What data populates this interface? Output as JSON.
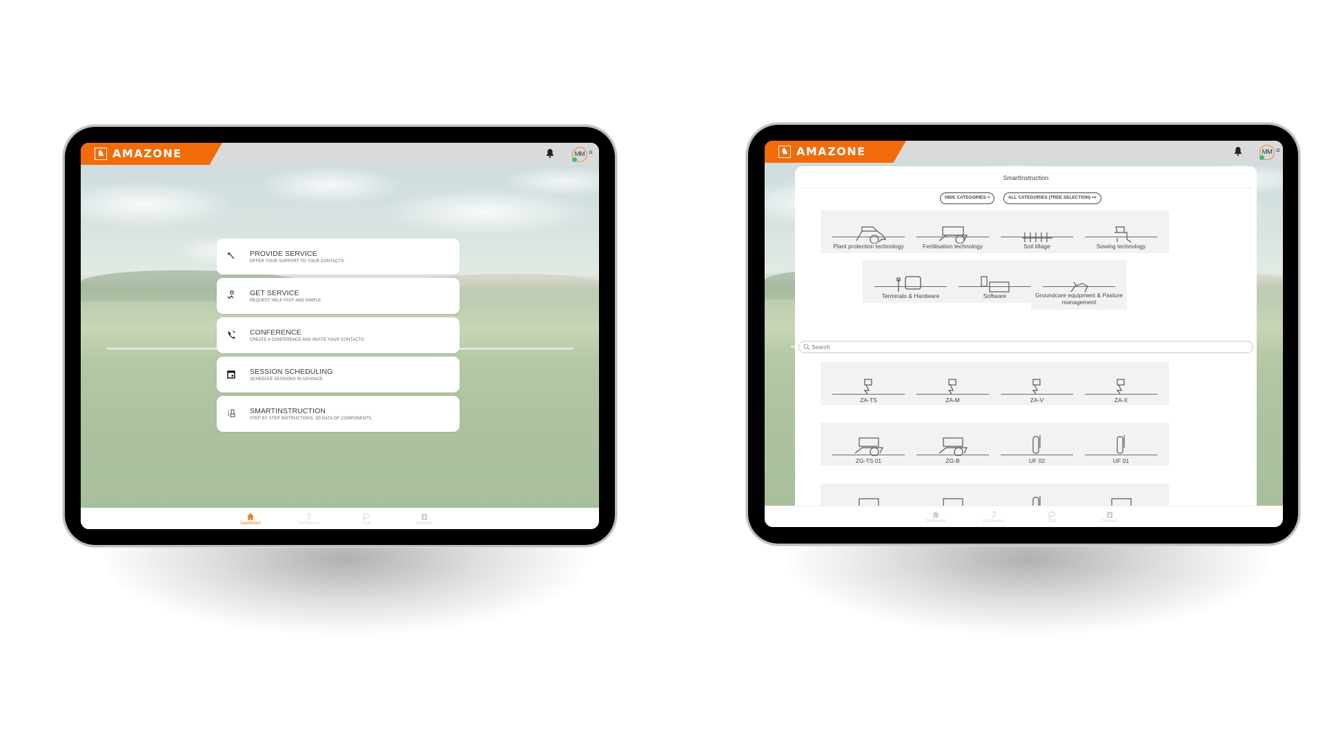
{
  "brand": {
    "name": "AMAZONE",
    "accent_color": "#f26b0a"
  },
  "header": {
    "user_initials": "MM",
    "notifications_icon": "bell-icon",
    "menu_icon": "hamburger-icon",
    "presence_status": "online"
  },
  "dashboard": {
    "cards": [
      {
        "title": "PROVIDE SERVICE",
        "subtitle": "OFFER YOUR SUPPORT TO YOUR CONTACTS.",
        "icon": "wrench-icon"
      },
      {
        "title": "GET SERVICE",
        "subtitle": "REQUEST HELP FAST AND SIMPLE.",
        "icon": "person-support-icon"
      },
      {
        "title": "CONFERENCE",
        "subtitle": "CREATE A CONFERENCE AND INVITE YOUR CONTACTS.",
        "icon": "phone-icon"
      },
      {
        "title": "SESSION SCHEDULING",
        "subtitle": "SCHEDULE SESSIONS IN ADVANCE.",
        "icon": "calendar-icon"
      },
      {
        "title": "SMARTINSTRUCTION",
        "subtitle": "STEP BY STEP INSTRUCTIONS, 3D DATA OF COMPONENTS.",
        "icon": "instruction-icon"
      }
    ]
  },
  "bottom_nav": {
    "items": [
      {
        "label": "Dashboard",
        "icon": "home-icon"
      },
      {
        "label": "Get Service",
        "icon": "person-support-icon"
      },
      {
        "label": "Chat",
        "icon": "chat-bubble-icon"
      },
      {
        "label": "Contacts",
        "icon": "contact-card-icon"
      }
    ],
    "left_active": "Dashboard"
  },
  "smartinstruction": {
    "title": "SmartInstruction",
    "hide_categories_label": "HIDE CATEGORIES",
    "tree_selection_label": "ALL CATEGORIES (TREE SELECTION)",
    "categories": [
      {
        "label": "Plant protection technology"
      },
      {
        "label": "Fertilisation technology"
      },
      {
        "label": "Soil tillage"
      },
      {
        "label": "Sowing technology"
      },
      {
        "label": "Terminals & Hardware"
      },
      {
        "label": "Software"
      },
      {
        "label": "Groundcare equipment & Pasture management"
      }
    ],
    "search": {
      "placeholder": "Search",
      "value": ""
    },
    "products": [
      {
        "label": "ZA-TS"
      },
      {
        "label": "ZA-M"
      },
      {
        "label": "ZA-V"
      },
      {
        "label": "ZA-X"
      },
      {
        "label": "ZG-TS 01"
      },
      {
        "label": "ZG-B"
      },
      {
        "label": "UF 02"
      },
      {
        "label": "UF 01"
      },
      {
        "label": ""
      },
      {
        "label": ""
      },
      {
        "label": ""
      },
      {
        "label": ""
      }
    ]
  }
}
